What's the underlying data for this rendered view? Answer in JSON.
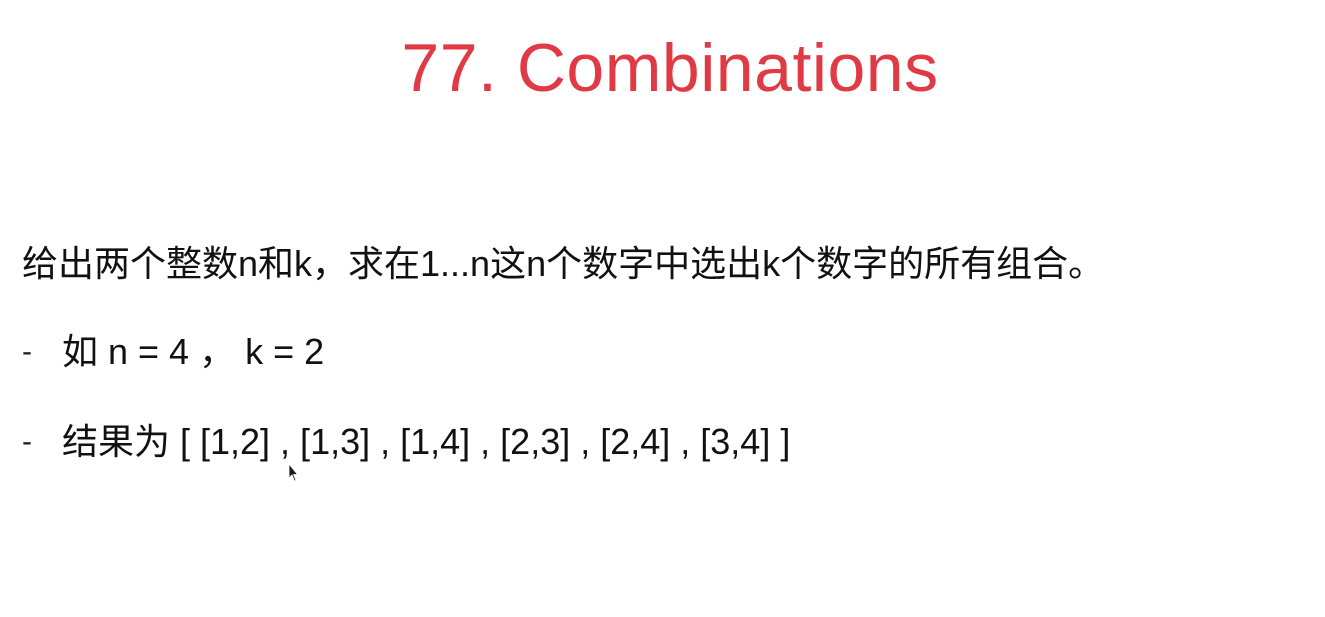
{
  "slide": {
    "title": "77. Combinations",
    "description": "给出两个整数n和k，求在1...n这n个数字中选出k个数字的所有组合。",
    "bullets": [
      {
        "marker": "-",
        "text": "如 n = 4 ， k = 2"
      },
      {
        "marker": "-",
        "text": "结果为 [ [1,2] , [1,3] , [1,4] , [2,3] , [2,4] , [3,4] ]"
      }
    ]
  },
  "colors": {
    "title": "#e03a45",
    "text": "#111111",
    "background": "#ffffff"
  },
  "icons": {
    "cursor": "mouse-pointer-icon"
  }
}
